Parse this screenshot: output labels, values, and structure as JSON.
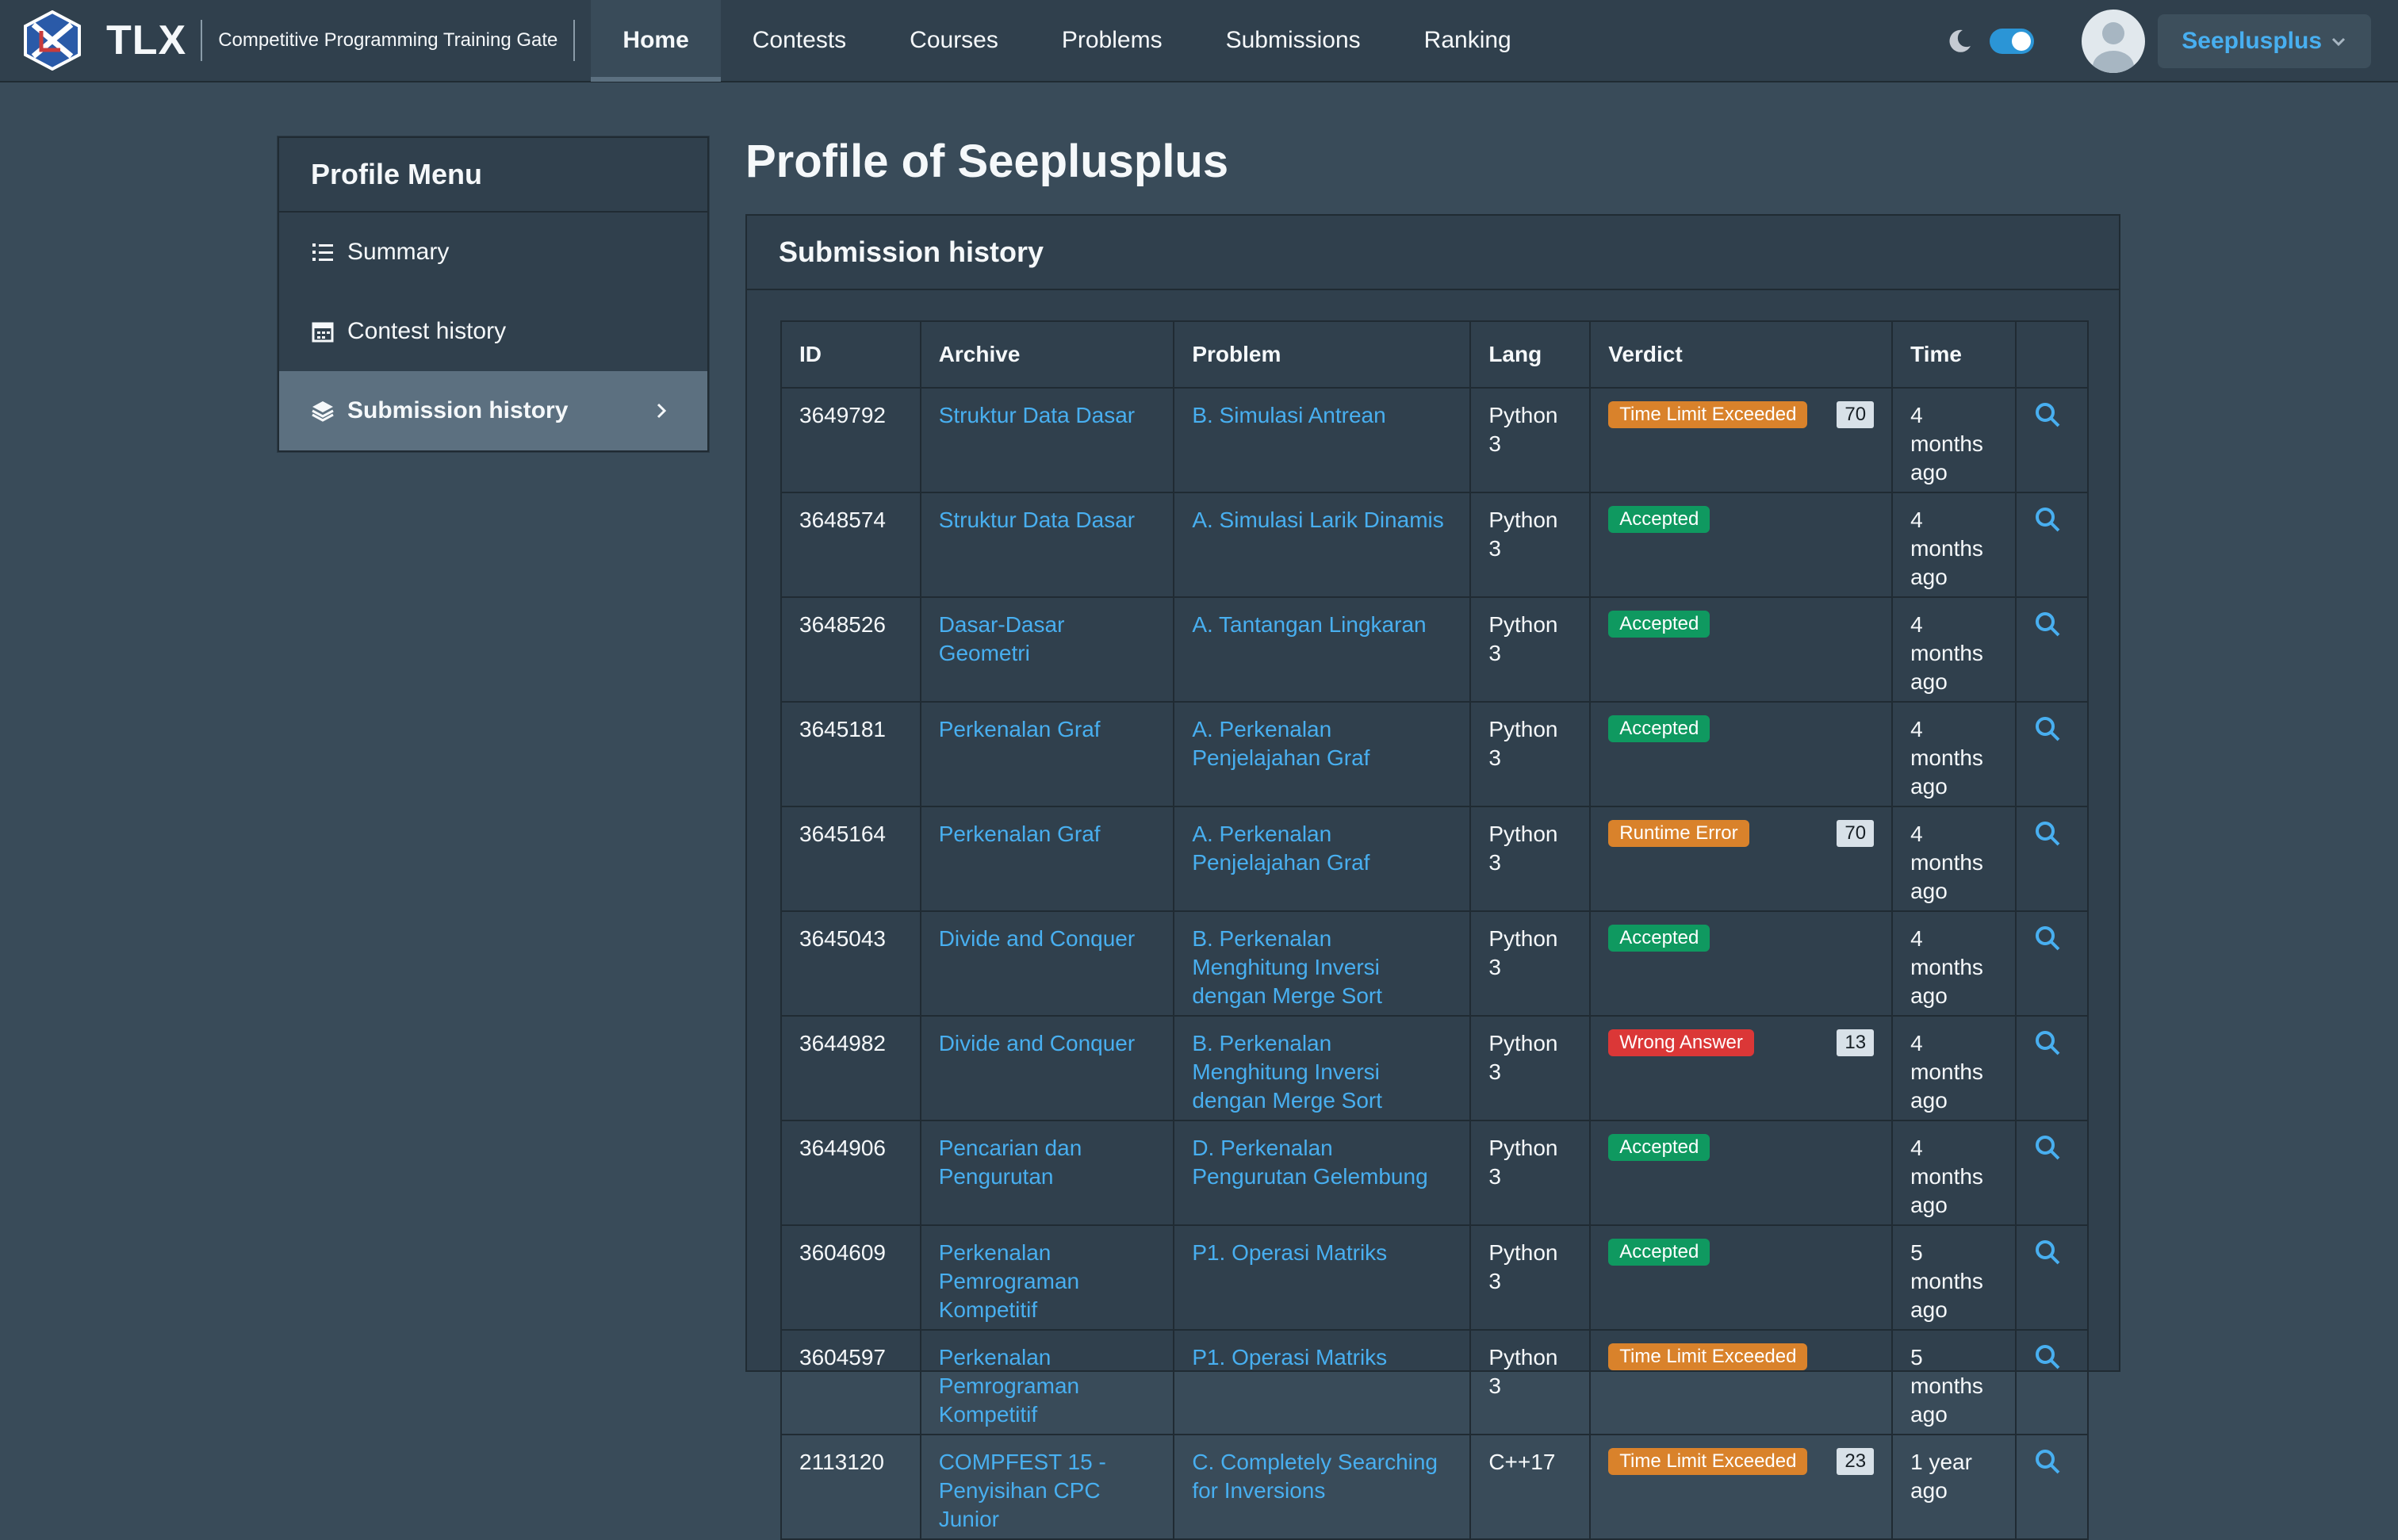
{
  "navbar": {
    "brand": "TLX",
    "tagline": "Competitive Programming Training Gate",
    "items": [
      "Home",
      "Contests",
      "Courses",
      "Problems",
      "Submissions",
      "Ranking"
    ],
    "active": "Home",
    "username": "Seeplusplus",
    "dark_mode": true
  },
  "sidebar": {
    "title": "Profile Menu",
    "items": [
      {
        "label": "Summary",
        "icon": "list-icon"
      },
      {
        "label": "Contest history",
        "icon": "calendar-icon"
      },
      {
        "label": "Submission history",
        "icon": "layers-icon"
      }
    ],
    "active": "Submission history"
  },
  "page": {
    "title": "Profile of Seeplusplus",
    "card_title": "Submission history"
  },
  "table": {
    "headers": [
      "ID",
      "Archive",
      "Problem",
      "Lang",
      "Verdict",
      "Time"
    ],
    "rows": [
      {
        "id": "3649792",
        "archive": "Struktur Data Dasar",
        "problem": "B. Simulasi Antrean",
        "lang": "Python 3",
        "verdict": "Time Limit Exceeded",
        "score": "70",
        "time": "4 months ago"
      },
      {
        "id": "3648574",
        "archive": "Struktur Data Dasar",
        "problem": "A. Simulasi Larik Dinamis",
        "lang": "Python 3",
        "verdict": "Accepted",
        "score": "",
        "time": "4 months ago"
      },
      {
        "id": "3648526",
        "archive": "Dasar-Dasar Geometri",
        "problem": "A. Tantangan Lingkaran",
        "lang": "Python 3",
        "verdict": "Accepted",
        "score": "",
        "time": "4 months ago"
      },
      {
        "id": "3645181",
        "archive": "Perkenalan Graf",
        "problem": "A. Perkenalan Penjelajahan Graf",
        "lang": "Python 3",
        "verdict": "Accepted",
        "score": "",
        "time": "4 months ago"
      },
      {
        "id": "3645164",
        "archive": "Perkenalan Graf",
        "problem": "A. Perkenalan Penjelajahan Graf",
        "lang": "Python 3",
        "verdict": "Runtime Error",
        "score": "70",
        "time": "4 months ago"
      },
      {
        "id": "3645043",
        "archive": "Divide and Conquer",
        "problem": "B. Perkenalan Menghitung Inversi dengan Merge Sort",
        "lang": "Python 3",
        "verdict": "Accepted",
        "score": "",
        "time": "4 months ago"
      },
      {
        "id": "3644982",
        "archive": "Divide and Conquer",
        "problem": "B. Perkenalan Menghitung Inversi dengan Merge Sort",
        "lang": "Python 3",
        "verdict": "Wrong Answer",
        "score": "13",
        "time": "4 months ago"
      },
      {
        "id": "3644906",
        "archive": "Pencarian dan Pengurutan",
        "problem": "D. Perkenalan Pengurutan Gelembung",
        "lang": "Python 3",
        "verdict": "Accepted",
        "score": "",
        "time": "4 months ago"
      },
      {
        "id": "3604609",
        "archive": "Perkenalan Pemrograman Kompetitif",
        "problem": "P1. Operasi Matriks",
        "lang": "Python 3",
        "verdict": "Accepted",
        "score": "",
        "time": "5 months ago"
      },
      {
        "id": "3604597",
        "archive": "Perkenalan Pemrograman Kompetitif",
        "problem": "P1. Operasi Matriks",
        "lang": "Python 3",
        "verdict": "Time Limit Exceeded",
        "score": "",
        "time": "5 months ago"
      },
      {
        "id": "2113120",
        "archive": "COMPFEST 15 - Penyisihan CPC Junior",
        "problem": "C. Completely Searching for Inversions",
        "lang": "C++17",
        "verdict": "Time Limit Exceeded",
        "score": "23",
        "time": "1 year ago"
      }
    ]
  },
  "colors": {
    "background": "#394b59",
    "panel": "#30404d",
    "link": "#48aff0",
    "accepted": "#0f9960",
    "warning": "#d9822b",
    "danger": "#db3737"
  }
}
